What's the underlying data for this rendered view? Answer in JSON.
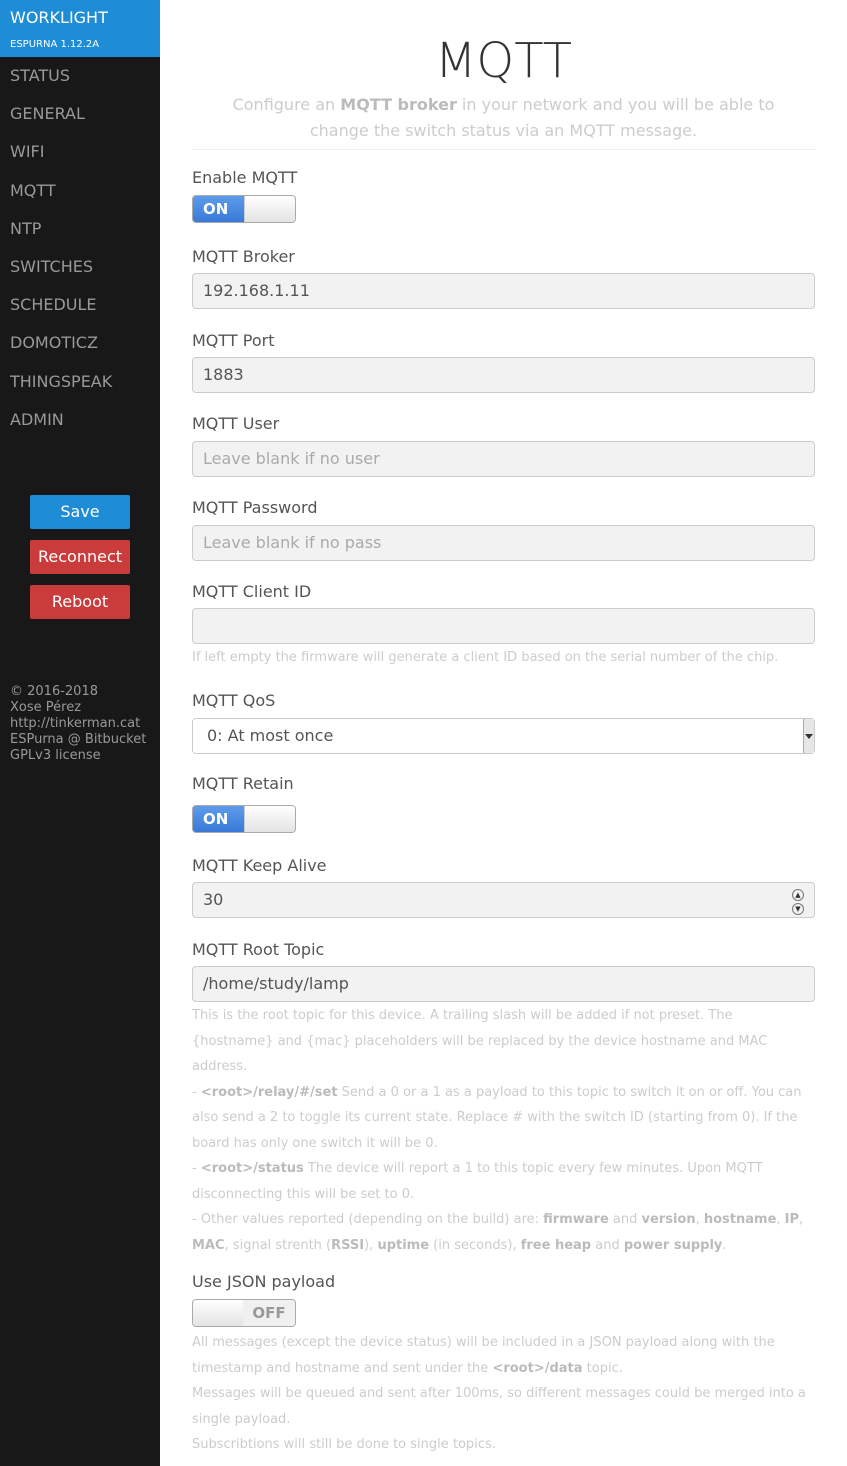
{
  "sidebar": {
    "brand_title": "WORKLIGHT",
    "brand_version": "ESPURNA 1.12.2A",
    "menu": [
      "STATUS",
      "GENERAL",
      "WIFI",
      "MQTT",
      "NTP",
      "SWITCHES",
      "SCHEDULE",
      "DOMOTICZ",
      "THINGSPEAK",
      "ADMIN"
    ],
    "buttons": {
      "save": "Save",
      "reconnect": "Reconnect",
      "reboot": "Reboot"
    },
    "footer": [
      "© 2016-2018",
      "Xose Pérez",
      "http://tinkerman.cat",
      "ESPurna @ Bitbucket",
      "GPLv3 license"
    ]
  },
  "header": {
    "title": "MQTT",
    "subtitle_pre": "Configure an ",
    "subtitle_bold": "MQTT broker",
    "subtitle_post": " in your network and you will be able to change the switch status via an MQTT message."
  },
  "form": {
    "enable_mqtt": {
      "label": "Enable MQTT",
      "state": "ON"
    },
    "broker": {
      "label": "MQTT Broker",
      "value": "192.168.1.11"
    },
    "port": {
      "label": "MQTT Port",
      "value": "1883"
    },
    "user": {
      "label": "MQTT User",
      "placeholder": "Leave blank if no user"
    },
    "password": {
      "label": "MQTT Password",
      "placeholder": "Leave blank if no pass"
    },
    "client_id": {
      "label": "MQTT Client ID",
      "value": "",
      "hint": "If left empty the firmware will generate a client ID based on the serial number of the chip."
    },
    "qos": {
      "label": "MQTT QoS",
      "selected": "0: At most once"
    },
    "retain": {
      "label": "MQTT Retain",
      "state": "ON"
    },
    "keep_alive": {
      "label": "MQTT Keep Alive",
      "value": "30"
    },
    "root_topic": {
      "label": "MQTT Root Topic",
      "value": "/home/study/lamp",
      "hint_intro": "This is the root topic for this device. A trailing slash will be added if not preset. The {hostname} and {mac} placeholders will be replaced by the device hostname and MAC address.",
      "hint_relay_code": "<root>/relay/#/set",
      "hint_relay_text": " Send a 0 or a 1 as a payload to this topic to switch it on or off. You can also send a 2 to toggle its current state. Replace # with the switch ID (starting from 0). If the board has only one switch it will be 0.",
      "hint_status_code": "<root>/status",
      "hint_status_text": " The device will report a 1 to this topic every few minutes. Upon MQTT disconnecting this will be set to 0.",
      "hint_other_pre": "Other values reported (depending on the build) are: ",
      "hint_other_firmware": "firmware",
      "hint_and1": " and ",
      "hint_other_version": "version",
      "hint_comma1": ", ",
      "hint_other_hostname": "hostname",
      "hint_comma2": ", ",
      "hint_other_ip": "IP",
      "hint_comma3": ", ",
      "hint_other_mac": "MAC",
      "hint_signal": ", signal strenth (",
      "hint_other_rssi": "RSSI",
      "hint_close": "), ",
      "hint_other_uptime": "uptime",
      "hint_inseconds": " (in seconds), ",
      "hint_other_freeheap": "free heap",
      "hint_and2": " and ",
      "hint_other_power": "power supply",
      "hint_end": "."
    },
    "json_payload": {
      "label": "Use JSON payload",
      "state": "OFF",
      "hint_pre": "All messages (except the device status) will be included in a JSON payload along with the timestamp and hostname and sent under the ",
      "hint_code": "<root>/data",
      "hint_post": " topic.",
      "hint_queue": "Messages will be queued and sent after 100ms, so different messages could be merged into a single payload.",
      "hint_subs": "Subscribtions will still be done to single topics."
    }
  }
}
